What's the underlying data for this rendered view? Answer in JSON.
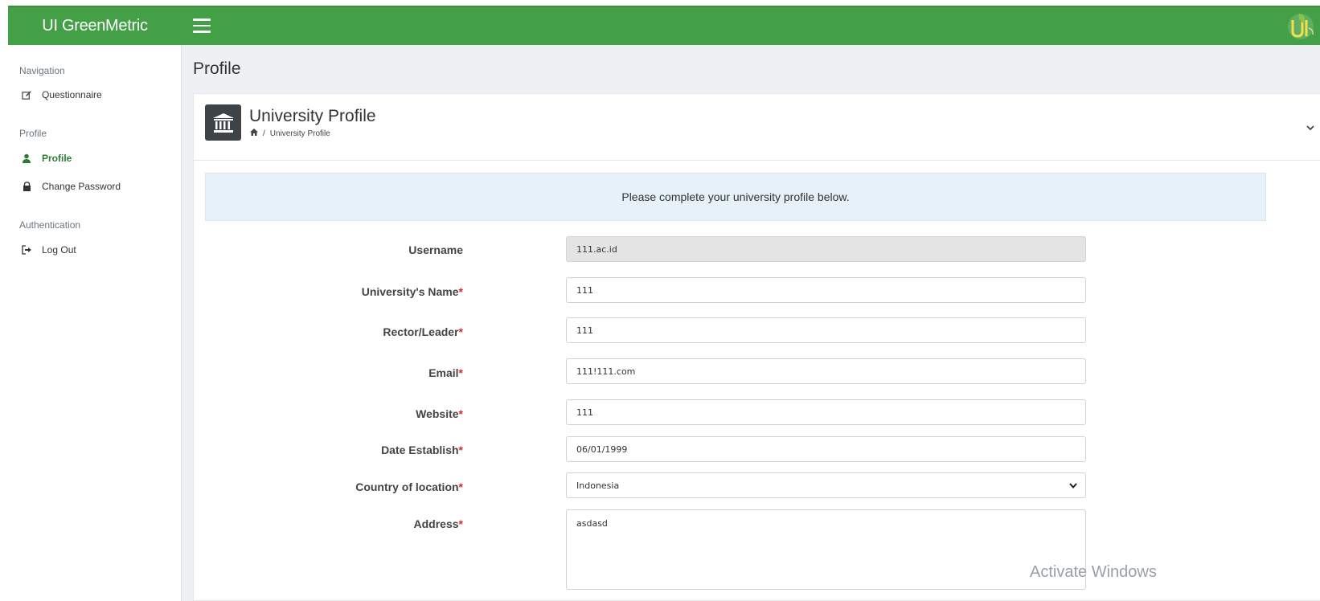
{
  "header": {
    "brand": "UI GreenMetric"
  },
  "sidebar": {
    "sections": [
      {
        "title": "Navigation"
      },
      {
        "title": "Profile"
      },
      {
        "title": "Authentication"
      }
    ],
    "items": [
      {
        "label": "Questionnaire",
        "icon": "edit-icon"
      },
      {
        "label": "Profile",
        "icon": "user-icon",
        "active": true
      },
      {
        "label": "Change Password",
        "icon": "lock-icon"
      },
      {
        "label": "Log Out",
        "icon": "sign-out-icon"
      }
    ]
  },
  "page": {
    "title": "Profile"
  },
  "card": {
    "title": "University Profile",
    "breadcrumb": {
      "sep": "/",
      "current": "University Profile"
    },
    "notice": "Please complete your university profile below."
  },
  "form": {
    "username": {
      "label": "Username",
      "value": "111.ac.id"
    },
    "university_name": {
      "label": "University's Name",
      "required": "*",
      "value": "111"
    },
    "rector": {
      "label": "Rector/Leader",
      "required": "*",
      "value": "111"
    },
    "email": {
      "label": "Email",
      "required": "*",
      "value": "111!111.com"
    },
    "website": {
      "label": "Website",
      "required": "*",
      "value": "111"
    },
    "date_establish": {
      "label": "Date Establish",
      "required": "*",
      "value": "06/01/1999"
    },
    "country": {
      "label": "Country of location",
      "required": "*",
      "value": "Indonesia"
    },
    "address": {
      "label": "Address",
      "required": "*",
      "value": "asdasd"
    }
  },
  "watermark": "Activate Windows",
  "colors": {
    "topbar": "#43a047",
    "active": "#2e7d32",
    "required": "#d32f2f"
  }
}
